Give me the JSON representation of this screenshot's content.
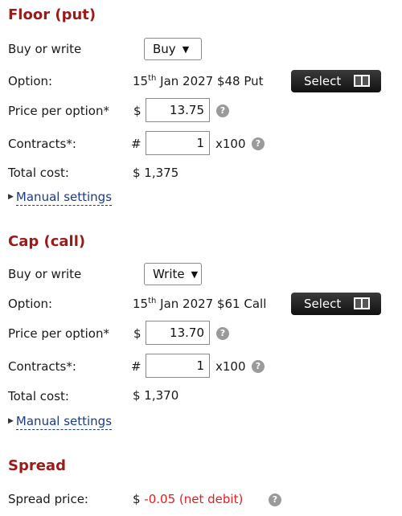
{
  "floor": {
    "heading": "Floor (put)",
    "buy_write_label": "Buy or write",
    "buy_write_value": "Buy",
    "option_label": "Option:",
    "option_day": "15",
    "option_day_suffix": "th",
    "option_rest": "Jan 2027 $48 Put",
    "select_label": "Select",
    "price_label": "Price per option*",
    "price_currency": "$",
    "price_value": "13.75",
    "contracts_label": "Contracts*:",
    "contracts_prefix": "#",
    "contracts_value": "1",
    "contracts_multiplier": "x100",
    "total_label": "Total cost:",
    "total_value": "$ 1,375",
    "manual_label": "Manual settings"
  },
  "cap": {
    "heading": "Cap (call)",
    "buy_write_label": "Buy or write",
    "buy_write_value": "Write",
    "option_label": "Option:",
    "option_day": "15",
    "option_day_suffix": "th",
    "option_rest": "Jan 2027 $61 Call",
    "select_label": "Select",
    "price_label": "Price per option*",
    "price_currency": "$",
    "price_value": "13.70",
    "contracts_label": "Contracts*:",
    "contracts_prefix": "#",
    "contracts_value": "1",
    "contracts_multiplier": "x100",
    "total_label": "Total cost:",
    "total_value": "$ 1,370",
    "manual_label": "Manual settings"
  },
  "spread": {
    "heading": "Spread",
    "price_label": "Spread price:",
    "price_currency": "$",
    "price_value": "-0.05 (net debit)"
  },
  "help_glyph": "?",
  "chevron_glyph": "⌵",
  "colors": {
    "heading": "#9b1a1a",
    "negative": "#e02020",
    "link": "#1a3a8a"
  }
}
